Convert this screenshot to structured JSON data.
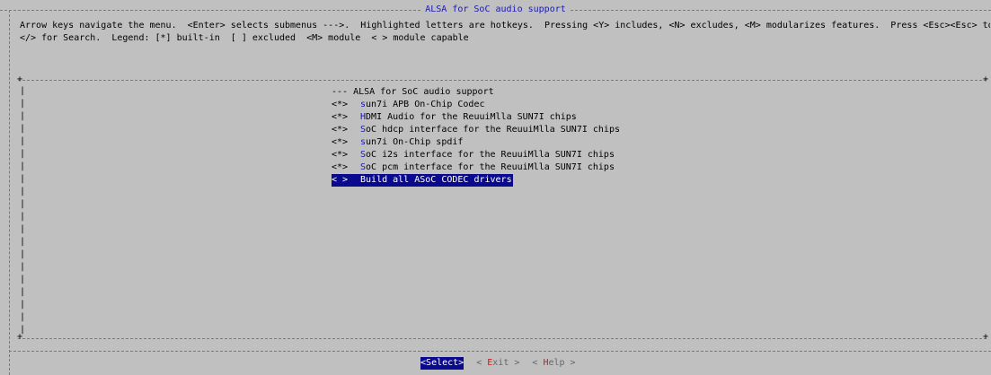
{
  "window": {
    "title": "ALSA for SoC audio support"
  },
  "help_text": {
    "line1": "Arrow keys navigate the menu.  <Enter> selects submenus --->.  Highlighted letters are hotkeys.  Pressing <Y> includes, <N> excludes, <M> modularizes features.  Press <Esc><Esc> to exit, <?> for Help,",
    "line2": "</> for Search.  Legend: [*] built-in  [ ] excluded  <M> module  < > module capable"
  },
  "menu": {
    "header": "--- ALSA for SoC audio support",
    "items": [
      {
        "state": "<*>",
        "hotkey": "s",
        "rest": "un7i APB On-Chip Codec"
      },
      {
        "state": "<*>",
        "hotkey": "H",
        "rest": "DMI Audio for the ReuuiMlla SUN7I chips"
      },
      {
        "state": "<*>",
        "hotkey": "S",
        "rest": "oC hdcp interface for the ReuuiMlla SUN7I chips"
      },
      {
        "state": "<*>",
        "hotkey": "s",
        "rest": "un7i On-Chip spdif"
      },
      {
        "state": "<*>",
        "hotkey": "S",
        "rest": "oC i2s interface for the ReuuiMlla SUN7I chips"
      },
      {
        "state": "<*>",
        "hotkey": "S",
        "rest": "oC pcm interface for the ReuuiMlla SUN7I chips"
      },
      {
        "state": "< >",
        "hotkey": "B",
        "rest": "uild all ASoC CODEC drivers"
      }
    ]
  },
  "buttons": {
    "select": {
      "open": "<",
      "hotkey": "S",
      "rest": "elect",
      "close": ">"
    },
    "exit": {
      "open": "< ",
      "hotkey": "E",
      "rest": "xit",
      "close": " >"
    },
    "help": {
      "open": "< ",
      "hotkey": "H",
      "rest": "elp",
      "close": " >"
    }
  },
  "colors": {
    "background": "#c0c0c0",
    "highlight": "#0a0a8e",
    "hotkey_menu": "#1a1aa8",
    "hotkey_button": "#c82020"
  }
}
